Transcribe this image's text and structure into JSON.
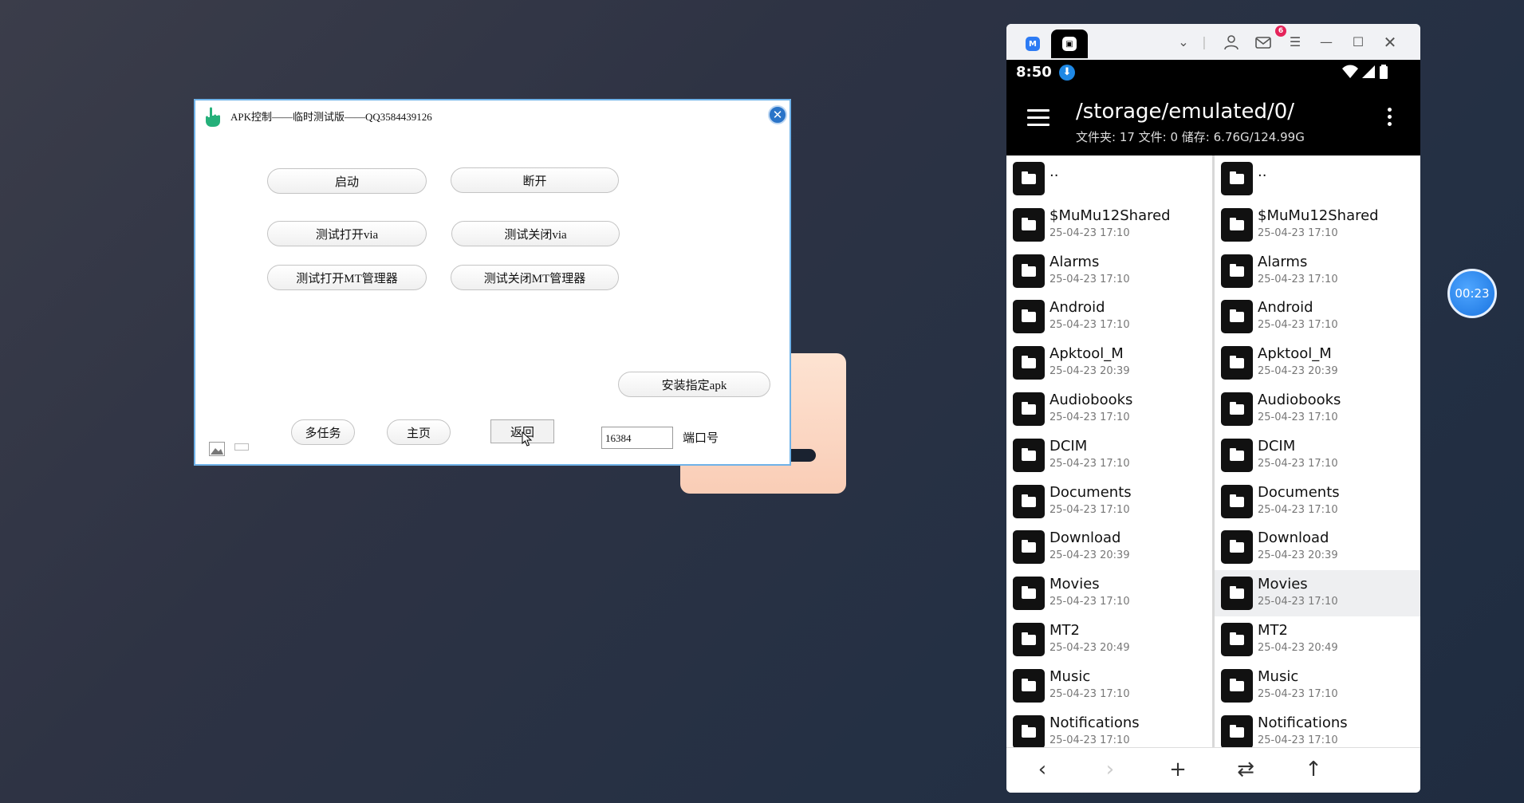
{
  "apk_window": {
    "title": "APK控制——临时测试版——QQ3584439126",
    "buttons": {
      "start": "启动",
      "disconnect": "断开",
      "test_open_via": "测试打开via",
      "test_close_via": "测试关闭via",
      "test_open_mt": "测试打开MT管理器",
      "test_close_mt": "测试关闭MT管理器",
      "install_apk": "安装指定apk",
      "multitask": "多任务",
      "home": "主页",
      "back": "返回"
    },
    "port_value": "16384",
    "port_label": "端口号"
  },
  "emulator": {
    "mail_badge": "6",
    "status_time": "8:50",
    "path_title": "/storage/emulated/0/",
    "path_subtitle": "文件夹: 17  文件: 0  储存: 6.76G/124.99G",
    "left_pane": [
      {
        "name": "..",
        "date": ""
      },
      {
        "name": "$MuMu12Shared",
        "date": "25-04-23 17:10"
      },
      {
        "name": "Alarms",
        "date": "25-04-23 17:10"
      },
      {
        "name": "Android",
        "date": "25-04-23 17:10"
      },
      {
        "name": "Apktool_M",
        "date": "25-04-23 20:39"
      },
      {
        "name": "Audiobooks",
        "date": "25-04-23 17:10"
      },
      {
        "name": "DCIM",
        "date": "25-04-23 17:10"
      },
      {
        "name": "Documents",
        "date": "25-04-23 17:10"
      },
      {
        "name": "Download",
        "date": "25-04-23 20:39"
      },
      {
        "name": "Movies",
        "date": "25-04-23 17:10"
      },
      {
        "name": "MT2",
        "date": "25-04-23 20:49"
      },
      {
        "name": "Music",
        "date": "25-04-23 17:10"
      },
      {
        "name": "Notifications",
        "date": "25-04-23 17:10"
      }
    ],
    "right_pane": [
      {
        "name": "..",
        "date": ""
      },
      {
        "name": "$MuMu12Shared",
        "date": "25-04-23 17:10"
      },
      {
        "name": "Alarms",
        "date": "25-04-23 17:10"
      },
      {
        "name": "Android",
        "date": "25-04-23 17:10"
      },
      {
        "name": "Apktool_M",
        "date": "25-04-23 20:39"
      },
      {
        "name": "Audiobooks",
        "date": "25-04-23 17:10"
      },
      {
        "name": "DCIM",
        "date": "25-04-23 17:10"
      },
      {
        "name": "Documents",
        "date": "25-04-23 17:10"
      },
      {
        "name": "Download",
        "date": "25-04-23 20:39"
      },
      {
        "name": "Movies",
        "date": "25-04-23 17:10"
      },
      {
        "name": "MT2",
        "date": "25-04-23 20:49"
      },
      {
        "name": "Music",
        "date": "25-04-23 17:10"
      },
      {
        "name": "Notifications",
        "date": "25-04-23 17:10"
      }
    ],
    "highlighted_right_row": "Movies",
    "bottom_nav": [
      "back-icon",
      "forward-icon",
      "plus-icon",
      "swap-icon",
      "up-arrow-icon"
    ]
  },
  "timer": "00:23"
}
